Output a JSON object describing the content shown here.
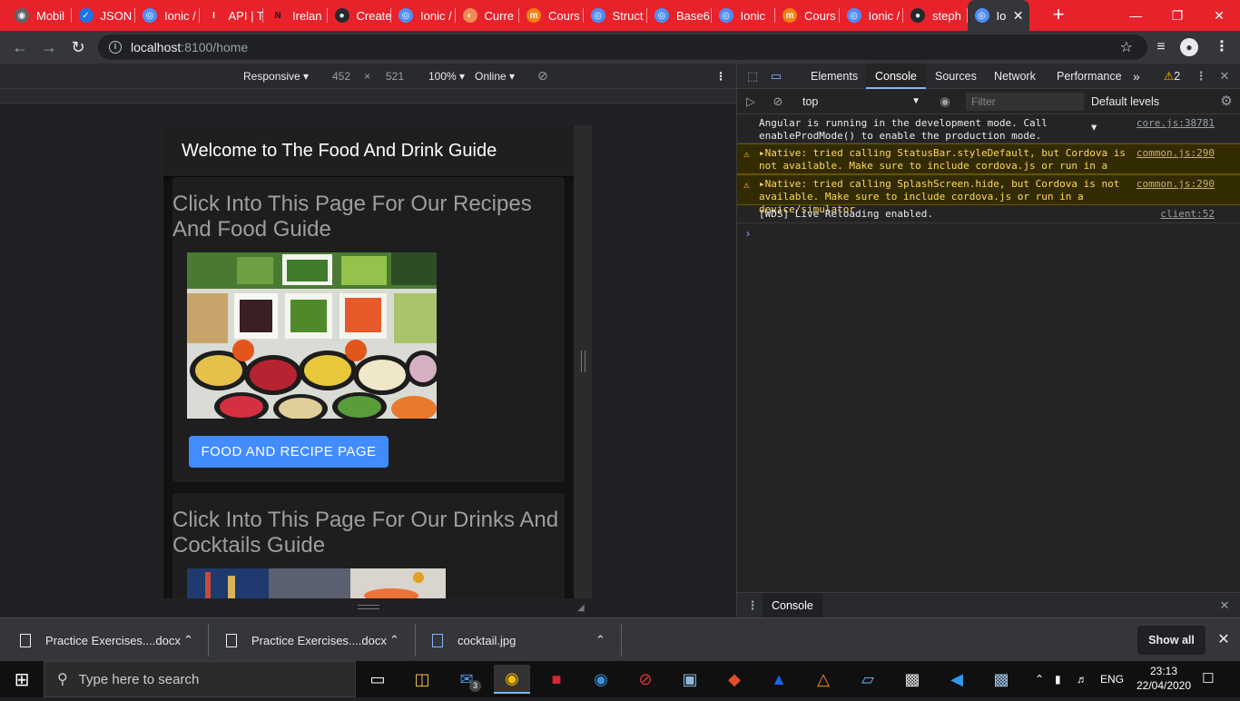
{
  "browser": {
    "tabs": [
      {
        "label": "Mobil",
        "icon": "globe-icon",
        "color": "#5f6368"
      },
      {
        "label": "JSON",
        "icon": "checkbox-icon",
        "color": "#1a73e8"
      },
      {
        "label": "Ionic /",
        "icon": "ionic-icon",
        "color": "#4e8ef7"
      },
      {
        "label": "API | T",
        "icon": "api-icon",
        "color": "#e8222b"
      },
      {
        "label": "Irelan",
        "icon": "netflix-icon",
        "color": "#e50914"
      },
      {
        "label": "Create",
        "icon": "github-icon",
        "color": "#24292e"
      },
      {
        "label": "Ionic /",
        "icon": "ionic-icon",
        "color": "#4e8ef7"
      },
      {
        "label": "Curre",
        "icon": "brain-icon",
        "color": "#f28b54"
      },
      {
        "label": "Cours",
        "icon": "moodle-icon",
        "color": "#f98012"
      },
      {
        "label": "Struct",
        "icon": "ionic-icon",
        "color": "#4e8ef7"
      },
      {
        "label": "Base6",
        "icon": "ionic-icon",
        "color": "#4e8ef7"
      },
      {
        "label": "Ionic",
        "icon": "ionic-icon",
        "color": "#4e8ef7"
      },
      {
        "label": "Cours",
        "icon": "moodle-icon",
        "color": "#f98012"
      },
      {
        "label": "Ionic /",
        "icon": "ionic-icon",
        "color": "#4e8ef7"
      },
      {
        "label": "steph",
        "icon": "github-icon",
        "color": "#24292e"
      },
      {
        "label": "Io",
        "icon": "ionic-icon",
        "color": "#4e8ef7"
      }
    ],
    "new_tab": "+",
    "url_host": "localhost",
    "url_path": ":8100/home"
  },
  "device_toolbar": {
    "mode": "Responsive",
    "width": "452",
    "times": "×",
    "height": "521",
    "zoom": "100%",
    "network": "Online"
  },
  "app": {
    "header_title": "Welcome to The Food And Drink Guide",
    "card1_title": "Click Into This Page For Our Recipes And Food Guide",
    "card1_button": "FOOD AND RECIPE PAGE",
    "card2_title": "Click Into This Page For Our Drinks And Cocktails Guide"
  },
  "devtools": {
    "tabs": [
      "Elements",
      "Console",
      "Sources",
      "Network",
      "Performance"
    ],
    "more_tabs": "»",
    "warning_count": "2",
    "context": "top",
    "filter_placeholder": "Filter",
    "levels": "Default levels",
    "messages": [
      {
        "type": "info",
        "text": "Angular is running in the development mode. Call\nenableProdMode() to enable the production mode.",
        "source": "core.js:38781"
      },
      {
        "type": "warn",
        "text": "▸Native: tried calling StatusBar.styleDefault, but Cordova is\nnot available. Make sure to include cordova.js or run in a device/simulator",
        "source": "common.js:290"
      },
      {
        "type": "warn",
        "text": "▸Native: tried calling SplashScreen.hide, but Cordova is not\navailable. Make sure to include cordova.js or run in a device/simulator",
        "source": "common.js:290"
      },
      {
        "type": "info",
        "text": "[WDS] Live Reloading enabled.",
        "source": "client:52"
      }
    ],
    "prompt": "›",
    "drawer_tab": "Console"
  },
  "downloads": {
    "items": [
      "Practice Exercises....docx",
      "Practice Exercises....docx",
      "cocktail.jpg"
    ],
    "show_all": "Show all"
  },
  "taskbar": {
    "search_placeholder": "Type here to search",
    "mail_badge": "3",
    "language": "ENG",
    "time": "23:13",
    "date": "22/04/2020"
  }
}
